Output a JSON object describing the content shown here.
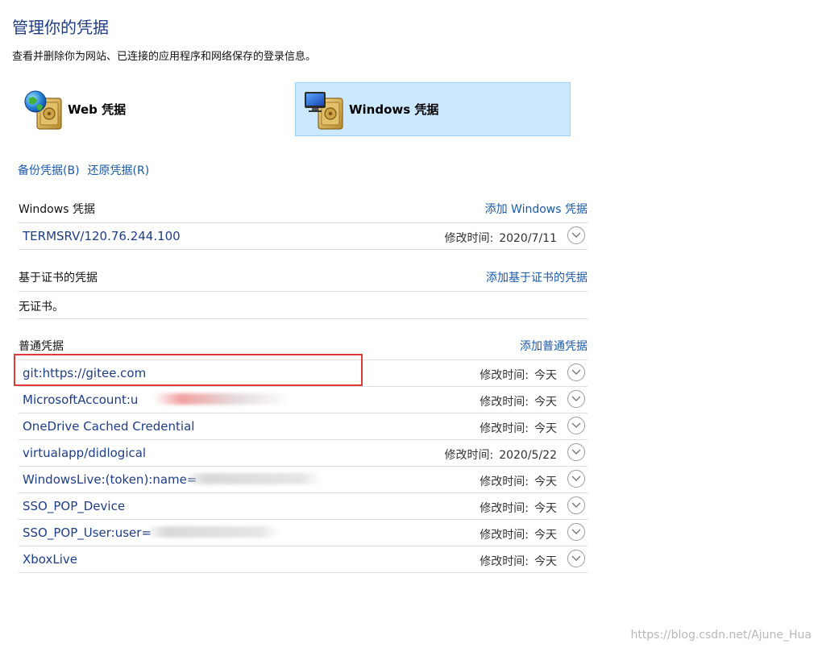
{
  "header": {
    "title": "管理你的凭据",
    "description": "查看并删除你为网站、已连接的应用程序和网络保存的登录信息。"
  },
  "tabs": [
    {
      "label": "Web 凭据",
      "icon": "globe-vault-icon",
      "selected": false
    },
    {
      "label": "Windows 凭据",
      "icon": "computer-vault-icon",
      "selected": true
    }
  ],
  "actions": {
    "backup_label": "备份凭据(B)",
    "restore_label": "还原凭据(R)"
  },
  "windows_credentials": {
    "title": "Windows 凭据",
    "add_label": "添加 Windows 凭据",
    "items": [
      {
        "name": "TERMSRV/120.76.244.100",
        "modified_label": "修改时间:",
        "modified": "2020/7/11"
      }
    ]
  },
  "certificate_credentials": {
    "title": "基于证书的凭据",
    "add_label": "添加基于证书的凭据",
    "empty_text": "无证书。"
  },
  "generic_credentials": {
    "title": "普通凭据",
    "add_label": "添加普通凭据",
    "items": [
      {
        "name": "git:https://gitee.com",
        "modified_label": "修改时间:",
        "modified": "今天"
      },
      {
        "name": "MicrosoftAccount:u",
        "modified_label": "修改时间:",
        "modified": "今天"
      },
      {
        "name": "OneDrive Cached Credential",
        "modified_label": "修改时间:",
        "modified": "今天"
      },
      {
        "name": "virtualapp/didlogical",
        "modified_label": "修改时间:",
        "modified": "2020/5/22"
      },
      {
        "name": "WindowsLive:(token):name=",
        "modified_label": "修改时间:",
        "modified": "今天"
      },
      {
        "name": "SSO_POP_Device",
        "modified_label": "修改时间:",
        "modified": "今天"
      },
      {
        "name": "SSO_POP_User:user=",
        "modified_label": "修改时间:",
        "modified": "今天"
      },
      {
        "name": "XboxLive",
        "modified_label": "修改时间:",
        "modified": "今天"
      }
    ]
  },
  "watermark": "https://blog.csdn.net/Ajune_Hua",
  "colors": {
    "title": "#1e3d87",
    "link": "#1a5aa8",
    "selected_tab_bg": "#cce8ff",
    "selected_tab_border": "#99d1ff",
    "highlight": "#e0393a"
  }
}
